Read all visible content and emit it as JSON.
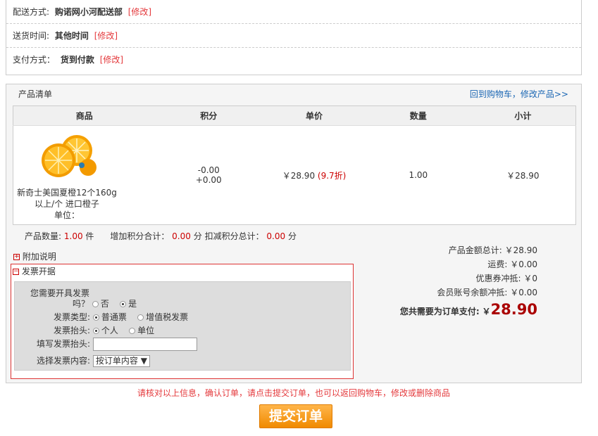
{
  "delivery": {
    "method_label": "配送方式:",
    "method_value": "购诺网小河配送部",
    "method_modify": "[修改]",
    "time_label": "送货时间:",
    "time_value": "其他时间",
    "time_modify": "[修改]",
    "pay_label": "支付方式：",
    "pay_value": "货到付款",
    "pay_modify": "[修改]"
  },
  "products": {
    "title": "产品清单",
    "back_link": "回到购物车，修改产品>>",
    "headers": [
      "商品",
      "积分",
      "单价",
      "数量",
      "小计"
    ],
    "item": {
      "name_line1": "新奇士美国夏橙12个160g",
      "name_line2": "以上/个 进口橙子",
      "name_line3": "单位：",
      "points1": "-0.00",
      "points2": "+0.00",
      "price": "￥28.90",
      "discount": "(9.7折)",
      "qty": "1.00",
      "subtotal": "￥28.90"
    },
    "summary": {
      "count_label": "产品数量:",
      "count_value": "1.00",
      "count_unit": "件",
      "add_label": "增加积分合计：",
      "add_value": "0.00",
      "add_unit": "分",
      "sub_label": "扣减积分总计：",
      "sub_value": "0.00",
      "sub_unit": "分"
    }
  },
  "totals": {
    "goods_label": "产品金额总计:",
    "goods_value": "￥28.90",
    "ship_label": "运费:",
    "ship_value": "￥0.00",
    "coupon_label": "优惠券冲抵:",
    "coupon_value": "￥0",
    "balance_label": "会员账号余额冲抵:",
    "balance_value": "￥0.00",
    "pay_label": "您共需要为订单支付:",
    "pay_currency": "￥",
    "pay_amount": "28.90"
  },
  "addon_label": "附加说明",
  "invoice": {
    "title": "发票开据",
    "need_q1": "您需要开具发票",
    "need_q2": "吗？",
    "no": "否",
    "yes": "是",
    "type_label": "发票类型:",
    "type_normal": "普通票",
    "type_vat": "增值税发票",
    "head_label": "发票抬头:",
    "head_person": "个人",
    "head_unit": "单位",
    "fill_label": "填写发票抬头:",
    "content_label": "选择发票内容:",
    "content_value": "按订单内容"
  },
  "notice": "请核对以上信息，确认订单，请点击提交订单，也可以返回购物车，修改或删除商品",
  "submit_label": "提交订单",
  "colors": {
    "accent": "#e4393c",
    "amount": "#aa0000",
    "button": "#f08a00"
  }
}
